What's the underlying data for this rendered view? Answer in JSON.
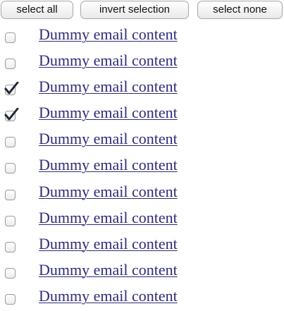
{
  "toolbar": {
    "select_all_label": "select all",
    "invert_selection_label": "invert selection",
    "select_none_label": "select none"
  },
  "colors": {
    "link": "#2f2b7a",
    "checkmark": "#1f2a3a",
    "button_border": "#a7a7a7"
  },
  "emails": [
    {
      "label": "Dummy email content",
      "checked": false
    },
    {
      "label": "Dummy email content",
      "checked": false
    },
    {
      "label": "Dummy email content",
      "checked": true
    },
    {
      "label": "Dummy email content",
      "checked": true
    },
    {
      "label": "Dummy email content",
      "checked": false
    },
    {
      "label": "Dummy email content",
      "checked": false
    },
    {
      "label": "Dummy email content",
      "checked": false
    },
    {
      "label": "Dummy email content",
      "checked": false
    },
    {
      "label": "Dummy email content",
      "checked": false
    },
    {
      "label": "Dummy email content",
      "checked": false
    },
    {
      "label": "Dummy email content",
      "checked": false
    }
  ]
}
